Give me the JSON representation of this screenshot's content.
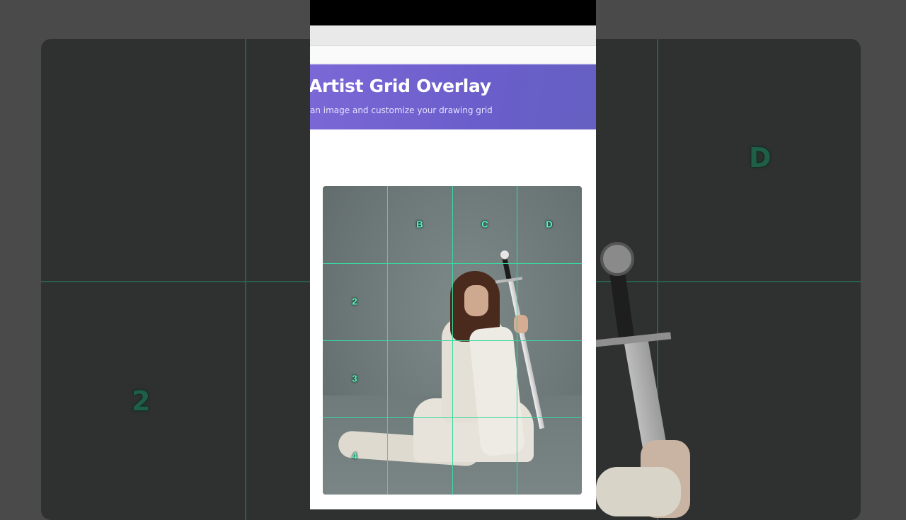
{
  "app": {
    "title": "Artist Grid Overlay",
    "subtitle": "an image and customize your drawing grid"
  },
  "grid": {
    "color": "#38d9a0",
    "column_labels": [
      "B",
      "C",
      "D"
    ],
    "row_labels": [
      "2",
      "3",
      "4"
    ]
  },
  "background": {
    "column_label": "D",
    "row_label": "2"
  },
  "colors": {
    "header_gradient_start": "#7b68d6",
    "header_gradient_end": "#6660c2"
  }
}
